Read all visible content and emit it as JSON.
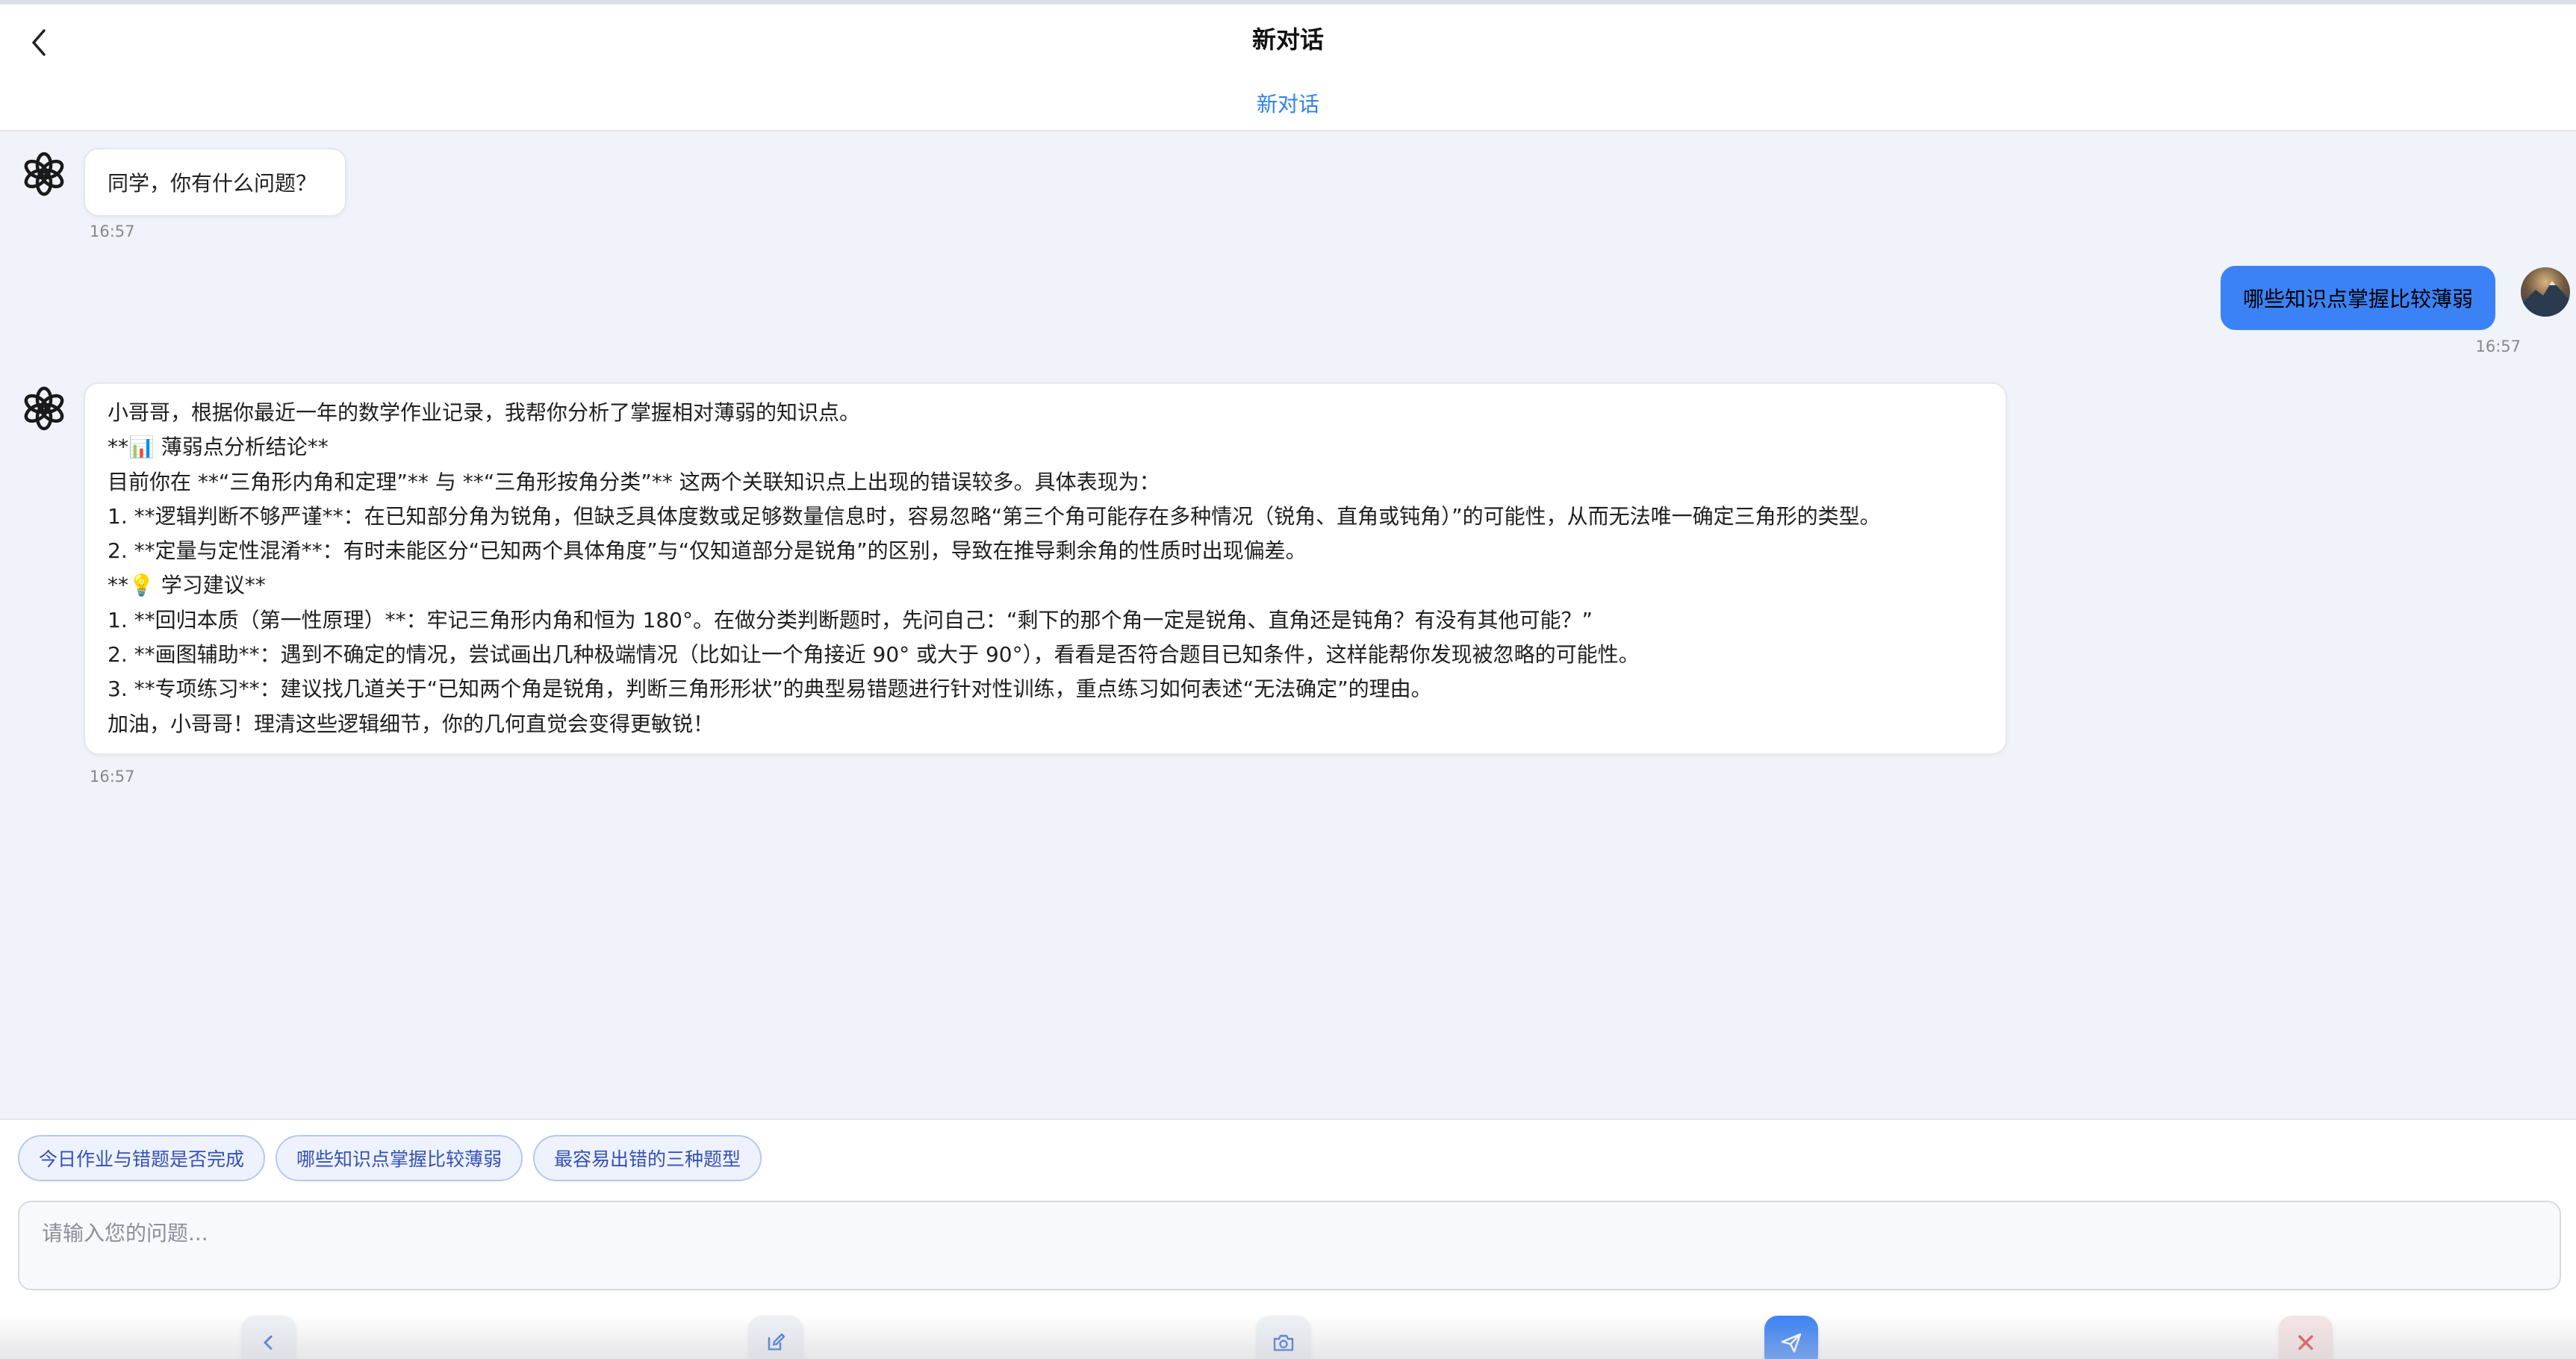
{
  "header": {
    "title": "新对话",
    "subtitle": "新对话"
  },
  "messages": {
    "greeting": {
      "text": "同学，你有什么问题？",
      "time": "16:57"
    },
    "user": {
      "text": "哪些知识点掌握比较薄弱",
      "time": "16:57"
    },
    "answer": {
      "lines": [
        "小哥哥，根据你最近一年的数学作业记录，我帮你分析了掌握相对薄弱的知识点。",
        "**📊 薄弱点分析结论**",
        "目前你在 **“三角形内角和定理”** 与 **“三角形按角分类”** 这两个关联知识点上出现的错误较多。具体表现为：",
        "1. **逻辑判断不够严谨**：在已知部分角为锐角，但缺乏具体度数或足够数量信息时，容易忽略“第三个角可能存在多种情况（锐角、直角或钝角）”的可能性，从而无法唯一确定三角形的类型。",
        "2. **定量与定性混淆**：有时未能区分“已知两个具体角度”与“仅知道部分是锐角”的区别，导致在推导剩余角的性质时出现偏差。",
        "**💡 学习建议**",
        "1. **回归本质（第一性原理）**：牢记三角形内角和恒为 180°。在做分类判断题时，先问自己：“剩下的那个角一定是锐角、直角还是钝角？有没有其他可能？”",
        "2. **画图辅助**：遇到不确定的情况，尝试画出几种极端情况（比如让一个角接近 90° 或大于 90°），看看是否符合题目已知条件，这样能帮你发现被忽略的可能性。",
        "3. **专项练习**：建议找几道关于“已知两个角是锐角，判断三角形形状”的典型易错题进行针对性训练，重点练习如何表述“无法确定”的理由。",
        "加油，小哥哥！理清这些逻辑细节，你的几何直觉会变得更敏锐！"
      ],
      "time": "16:57"
    }
  },
  "suggestions": [
    "今日作业与错题是否完成",
    "哪些知识点掌握比较薄弱",
    "最容易出错的三种题型"
  ],
  "input": {
    "placeholder": "请输入您的问题..."
  },
  "icons": {
    "back": "chevron-left-icon",
    "bot": "openai-logo-icon",
    "toolbar": [
      "chevron-left-icon",
      "edit-icon",
      "camera-icon",
      "send-icon",
      "close-icon"
    ]
  },
  "colors": {
    "accent": "#3b82f6",
    "link": "#2f80ed",
    "close": "#e04848"
  }
}
